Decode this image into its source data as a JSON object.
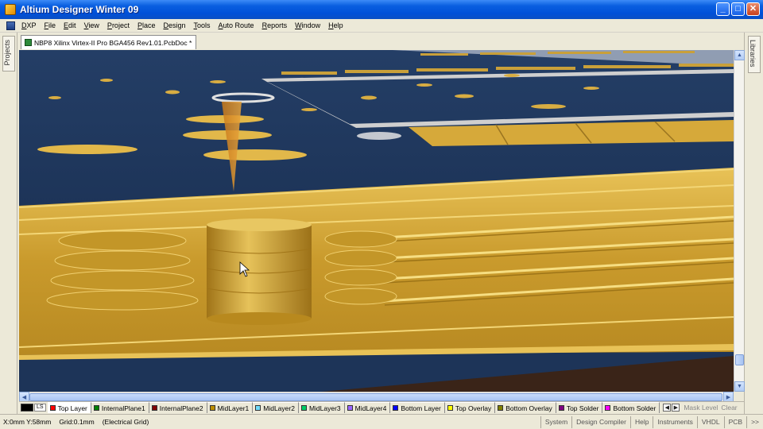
{
  "window": {
    "title": "Altium Designer Winter 09",
    "minimize_symbol": "_",
    "maximize_symbol": "□",
    "close_symbol": "✕"
  },
  "menu": {
    "items": [
      "DXP",
      "File",
      "Edit",
      "View",
      "Project",
      "Place",
      "Design",
      "Tools",
      "Auto Route",
      "Reports",
      "Window",
      "Help"
    ]
  },
  "side_panels": {
    "left_label": "Projects",
    "right_label": "Libraries"
  },
  "document": {
    "tab_label": "NBP8 Xilinx Virtex-II Pro BGA456 Rev1.01.PcbDoc *"
  },
  "layer_bar": {
    "ls_label": "LS",
    "layers": [
      {
        "name": "Top Layer",
        "color": "#ff0000"
      },
      {
        "name": "InternalPlane1",
        "color": "#008000"
      },
      {
        "name": "InternalPlane2",
        "color": "#800000"
      },
      {
        "name": "MidLayer1",
        "color": "#bc8e00"
      },
      {
        "name": "MidLayer2",
        "color": "#70dbfa"
      },
      {
        "name": "MidLayer3",
        "color": "#00cc66"
      },
      {
        "name": "MidLayer4",
        "color": "#9966ff"
      },
      {
        "name": "Bottom Layer",
        "color": "#0000ff"
      },
      {
        "name": "Top Overlay",
        "color": "#ffff00"
      },
      {
        "name": "Bottom Overlay",
        "color": "#808000"
      },
      {
        "name": "Top Solder",
        "color": "#800080"
      },
      {
        "name": "Bottom Solder",
        "color": "#ff00ff"
      }
    ],
    "mask_level": "Mask Level",
    "clear": "Clear"
  },
  "status": {
    "coords": "X:0mm Y:58mm",
    "grid": "Grid:0.1mm",
    "grid_type": "(Electrical Grid)",
    "panels": [
      "System",
      "Design Compiler",
      "Help",
      "Instruments",
      "VHDL",
      "PCB"
    ],
    "more": ">>"
  },
  "colors": {
    "board_blue": "#1b3560",
    "copper": "#d2a536",
    "copper_light": "#e8c257",
    "silkscreen": "#cfcfcf"
  }
}
